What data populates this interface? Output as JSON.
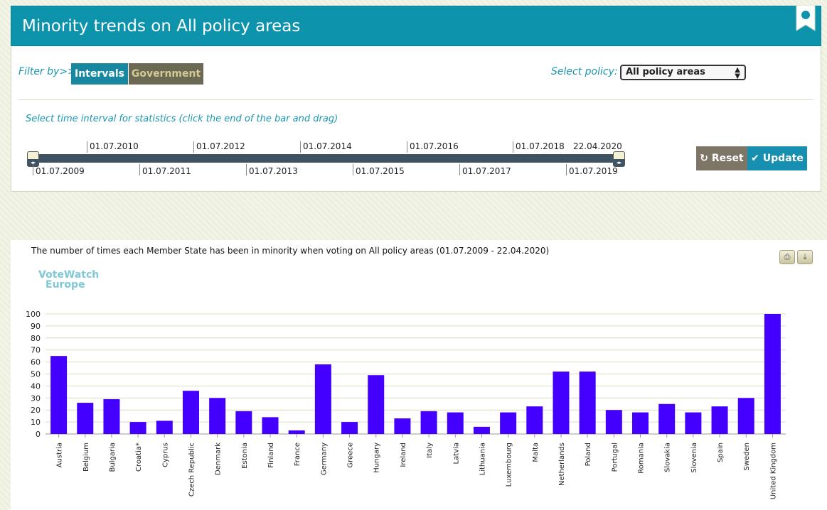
{
  "header": {
    "title": "Minority trends on All policy areas"
  },
  "filter": {
    "label": "Filter by>>",
    "intervals_label": "Intervals",
    "government_label": "Government",
    "select_policy_label": "Select policy:",
    "policy_value": "All policy areas"
  },
  "interval": {
    "hint": "Select time interval for statistics (click the end of the bar and drag)",
    "ticks_top": [
      "01.07.2010",
      "01.07.2012",
      "01.07.2014",
      "01.07.2016",
      "01.07.2018",
      "22.04.2020"
    ],
    "ticks_bottom": [
      "01.07.2009",
      "01.07.2011",
      "01.07.2013",
      "01.07.2015",
      "01.07.2017",
      "01.07.2019"
    ],
    "reset_label": "Reset",
    "update_label": "Update"
  },
  "logo": {
    "line1": "VoteWatch",
    "line2": "Europe"
  },
  "chart_data": {
    "type": "bar",
    "title": "The number of times each Member State has been in minority when voting on All policy areas (01.07.2009 - 22.04.2020)",
    "categories": [
      "Austria",
      "Belgium",
      "Bulgaria",
      "Croatia*",
      "Cyprus",
      "Czech Republic",
      "Denmark",
      "Estonia",
      "Finland",
      "France",
      "Germany",
      "Greece",
      "Hungary",
      "Ireland",
      "Italy",
      "Latvia",
      "Lithuania",
      "Luxembourg",
      "Malta",
      "Netherlands",
      "Poland",
      "Portugal",
      "Romania",
      "Slovakia",
      "Slovenia",
      "Spain",
      "Sweden",
      "United Kingdom"
    ],
    "values": [
      65,
      26,
      29,
      10,
      11,
      36,
      30,
      19,
      14,
      3,
      58,
      10,
      49,
      13,
      19,
      18,
      6,
      18,
      23,
      52,
      52,
      20,
      18,
      25,
      18,
      23,
      30,
      100
    ],
    "ylim": [
      0,
      100
    ],
    "yticks": [
      0,
      10,
      20,
      30,
      40,
      50,
      60,
      70,
      80,
      90,
      100
    ],
    "bar_color": "#4400ff",
    "grid": true
  }
}
